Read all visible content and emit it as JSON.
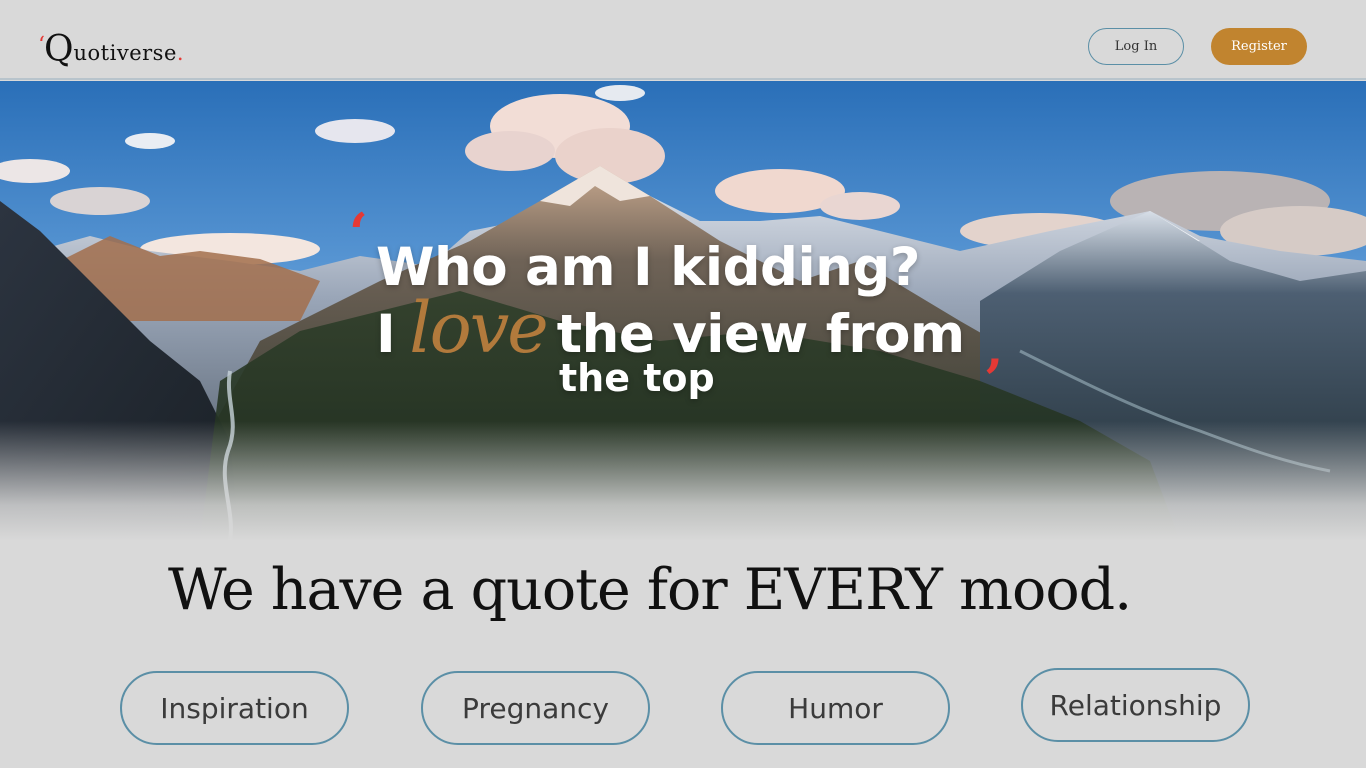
{
  "header": {
    "logo": {
      "mark": "‘",
      "letter": "Q",
      "rest": "uotiverse",
      "dot": "."
    },
    "login_label": "Log In",
    "register_label": "Register"
  },
  "hero": {
    "quote_open": "‘",
    "line1": "Who am I kidding?",
    "line2_prefix": "I",
    "line2_script": "love",
    "line2_suffix": "the view from",
    "line3": "the top",
    "quote_close": "’"
  },
  "tagline": "We have a quote for EVERY mood.",
  "categories": [
    "Inspiration",
    "Pregnancy",
    "Humor",
    "Relationship"
  ],
  "colors": {
    "accent_red": "#e53935",
    "register_bg": "#c1842f",
    "pill_border": "#5b8fa6",
    "page_bg": "#d9d9d9"
  }
}
